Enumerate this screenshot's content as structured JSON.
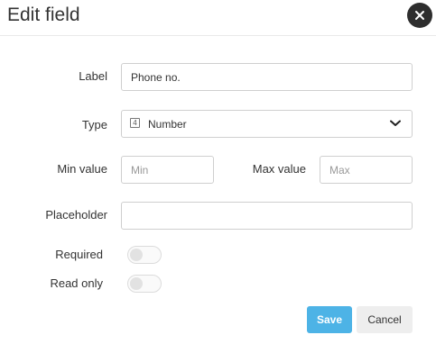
{
  "dialog": {
    "title": "Edit field",
    "close_icon": "close-icon"
  },
  "form": {
    "label": {
      "caption": "Label",
      "value": "Phone no."
    },
    "type": {
      "caption": "Type",
      "icon": "number-type-icon",
      "icon_glyph": "4",
      "value": "Number",
      "chevron": "chevron-down-icon"
    },
    "min_value": {
      "caption": "Min value",
      "placeholder": "Min",
      "value": ""
    },
    "max_value": {
      "caption": "Max value",
      "placeholder": "Max",
      "value": ""
    },
    "placeholder": {
      "caption": "Placeholder",
      "value": ""
    },
    "required": {
      "caption": "Required",
      "checked": false
    },
    "read_only": {
      "caption": "Read only",
      "checked": false
    }
  },
  "buttons": {
    "save": "Save",
    "cancel": "Cancel"
  },
  "colors": {
    "primary": "#4db3e6",
    "close_bg": "#2e2e2e",
    "border": "#cfcfcf"
  }
}
